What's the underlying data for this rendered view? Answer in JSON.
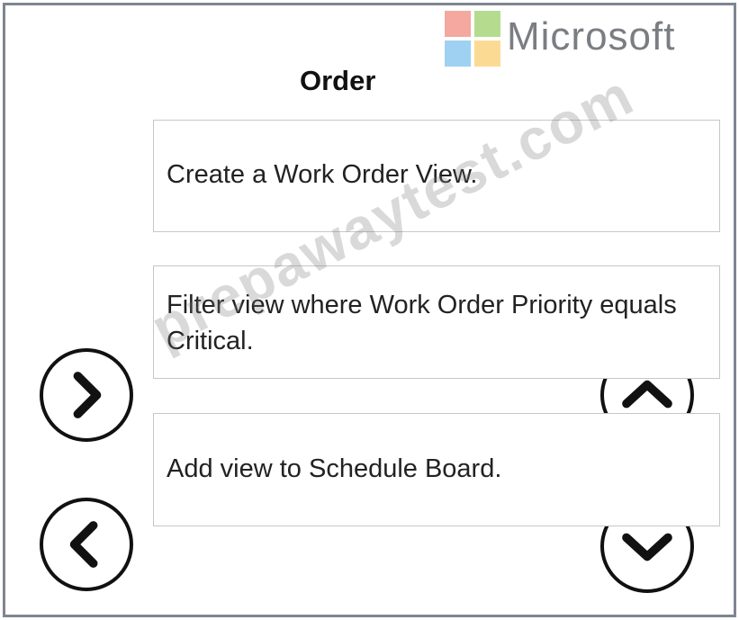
{
  "brand": {
    "name": "Microsoft",
    "logo_colors": [
      "#f25022",
      "#7fba00",
      "#00a4ef",
      "#ffb900"
    ]
  },
  "order": {
    "title": "Order",
    "items": [
      {
        "label": "Create a Work Order View."
      },
      {
        "label": "Filter view where Work Order Priority equals Critical."
      },
      {
        "label": "Add view to Schedule Board."
      }
    ]
  },
  "controls": {
    "move_right_icon": "chevron-right-icon",
    "move_left_icon": "chevron-left-icon",
    "move_up_icon": "chevron-up-icon",
    "move_down_icon": "chevron-down-icon"
  },
  "watermark": "prepawaytest.com"
}
